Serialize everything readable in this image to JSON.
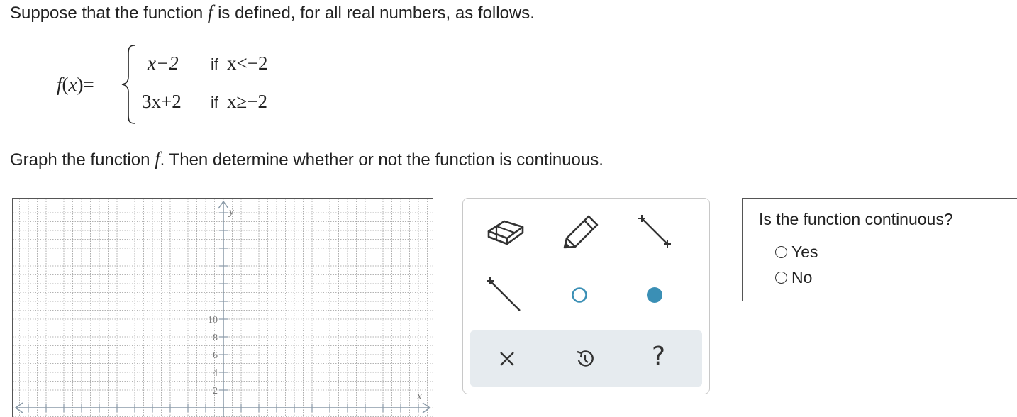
{
  "intro": {
    "before": "Suppose that the function",
    "fvar": "f",
    "after": "is defined, for all real numbers, as follows."
  },
  "equation": {
    "fname": "f",
    "xvar": "x",
    "cases": [
      {
        "expr": "x−2",
        "if": "if",
        "cond": "x<−2"
      },
      {
        "expr": "3x+2",
        "if": "if",
        "cond": "x≥−2"
      }
    ]
  },
  "instruction": {
    "before": "Graph the function",
    "fvar": "f",
    "after": ". Then determine whether or not the function is continuous."
  },
  "graph": {
    "y_axis_label": "y",
    "x_axis_label": "x",
    "y_tick_labels": [
      "10",
      "8",
      "6",
      "4",
      "2"
    ],
    "y_ticks": [
      10,
      8,
      6,
      4,
      2
    ],
    "colors": {
      "grid": "#9a9a9a",
      "axis": "#8a9aa8",
      "tick_text": "#777777"
    }
  },
  "toolbox": {
    "tools": [
      {
        "name": "eraser-icon"
      },
      {
        "name": "pencil-icon"
      },
      {
        "name": "line-icon"
      },
      {
        "name": "ray-icon"
      },
      {
        "name": "open-circle-icon"
      },
      {
        "name": "closed-circle-icon"
      }
    ],
    "actions": [
      {
        "name": "close-icon"
      },
      {
        "name": "undo-icon"
      },
      {
        "name": "help-icon",
        "glyph": "?"
      }
    ],
    "colors": {
      "icon": "#333333",
      "accent": "#3a8fb5",
      "tray": "#e6ebef"
    }
  },
  "question": {
    "title": "Is the function continuous?",
    "options": [
      {
        "label": "Yes",
        "selected": false
      },
      {
        "label": "No",
        "selected": false
      }
    ]
  }
}
